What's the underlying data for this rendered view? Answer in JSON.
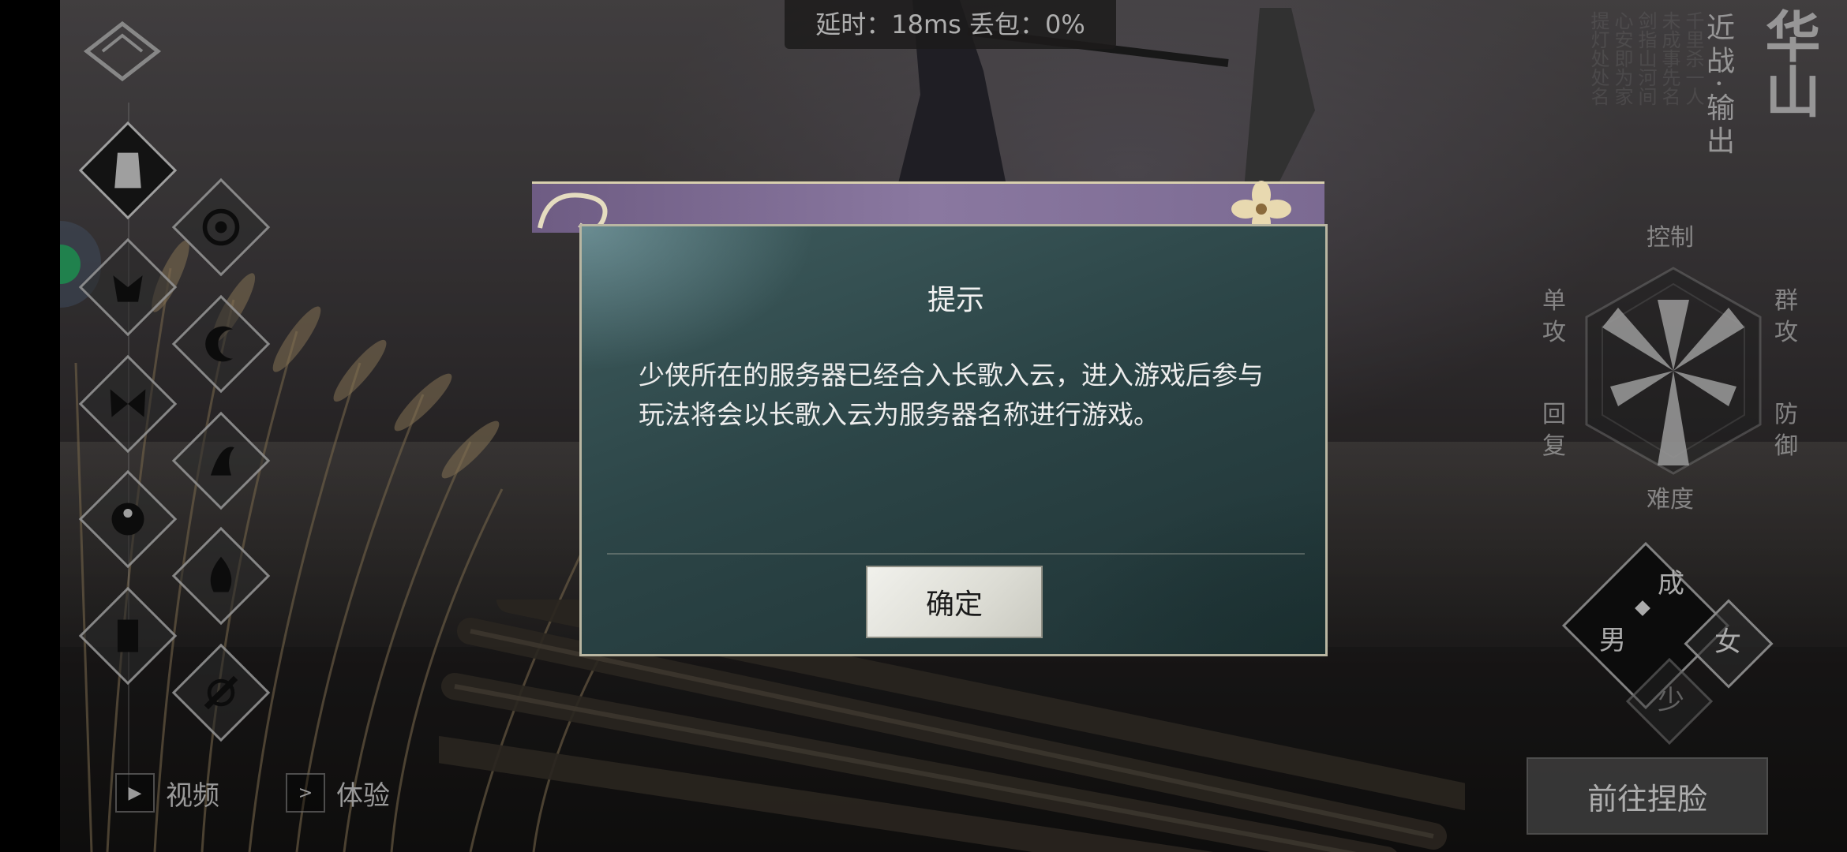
{
  "status": {
    "latency_label": "延时：",
    "latency_value": "18ms",
    "packet_loss_label": "丢包：",
    "packet_loss_value": "0%"
  },
  "left_menu": {
    "icons": [
      "warrior-icon",
      "compass-icon",
      "wolf-icon",
      "crescent-icon",
      "butterfly-icon",
      "phoenix-icon",
      "taiji-icon",
      "flame-icon",
      "totem-icon",
      "sword-icon"
    ],
    "video_label": "视频",
    "experience_label": "体验"
  },
  "sect": {
    "name": "华山",
    "role": "近战·输出",
    "poem_lines": [
      "千里杀一人",
      "未成事先名",
      "剑指山河间",
      "心安即为家",
      "提灯处处名"
    ]
  },
  "radar": {
    "labels": {
      "top": "控制",
      "top_left": "单攻",
      "top_right": "群攻",
      "bottom_left": "回复",
      "bottom_right": "防御",
      "bottom": "难度"
    }
  },
  "gender": {
    "adult_label": "成",
    "male_label": "男",
    "female_label": "女",
    "young_label": "少"
  },
  "face_button_label": "前往捏脸",
  "dialog": {
    "title": "提示",
    "message": "少侠所在的服务器已经合入长歌入云，进入游戏后参与玩法将会以长歌入云为服务器名称进行游戏。",
    "confirm_label": "确定"
  },
  "colors": {
    "dialog_bg": "#2c4547",
    "dialog_header": "#7b6a92",
    "ok_button": "#e6e6e0",
    "green_indicator": "#2db36b"
  }
}
